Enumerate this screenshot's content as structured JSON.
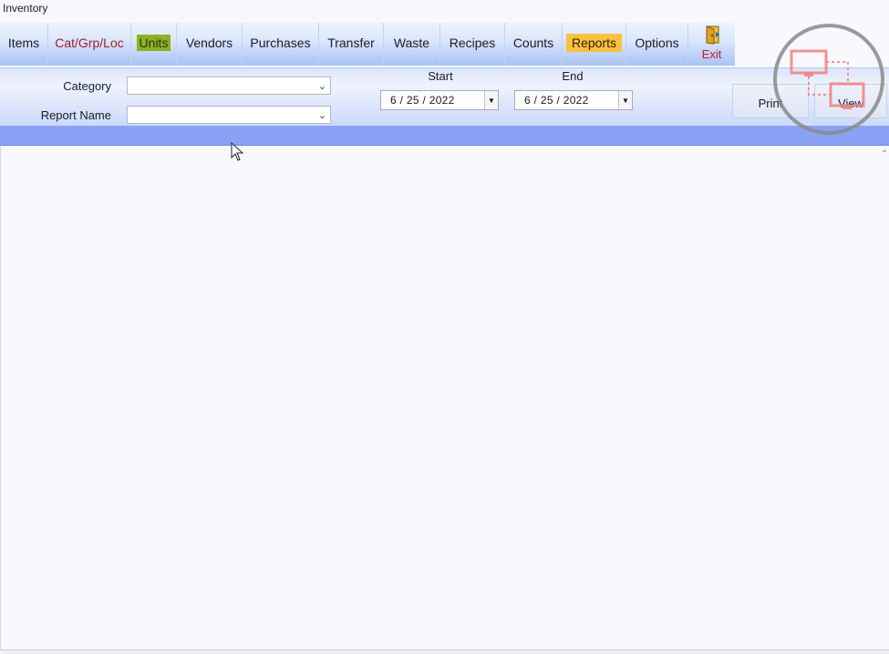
{
  "window": {
    "title": "Inventory"
  },
  "tabs": [
    {
      "id": "items",
      "label": "Items",
      "style": "normal"
    },
    {
      "id": "catgrploc",
      "label": "Cat/Grp/Loc",
      "style": "red"
    },
    {
      "id": "units",
      "label": "Units",
      "style": "green"
    },
    {
      "id": "vendors",
      "label": "Vendors",
      "style": "normal"
    },
    {
      "id": "purchases",
      "label": "Purchases",
      "style": "normal"
    },
    {
      "id": "transfer",
      "label": "Transfer",
      "style": "normal"
    },
    {
      "id": "waste",
      "label": "Waste",
      "style": "normal"
    },
    {
      "id": "recipes",
      "label": "Recipes",
      "style": "normal"
    },
    {
      "id": "counts",
      "label": "Counts",
      "style": "normal"
    },
    {
      "id": "reports",
      "label": "Reports",
      "style": "orange"
    },
    {
      "id": "options",
      "label": "Options",
      "style": "normal"
    }
  ],
  "exit": {
    "label": "Exit",
    "icon": "exit-door-icon"
  },
  "filters": {
    "category_label": "Category",
    "category_value": "",
    "report_name_label": "Report Name",
    "report_name_value": ""
  },
  "dates": {
    "start_label": "Start",
    "start_value": "6 / 25 / 2022",
    "end_label": "End",
    "end_value": "6 / 25 / 2022"
  },
  "buttons": {
    "print_label": "Print",
    "view_label": "View"
  },
  "colors": {
    "accent_blue": "#8aa2f6",
    "reports_tab": "#f8c13e",
    "units_tab": "#8fb021",
    "exit_red": "#c0202a"
  }
}
